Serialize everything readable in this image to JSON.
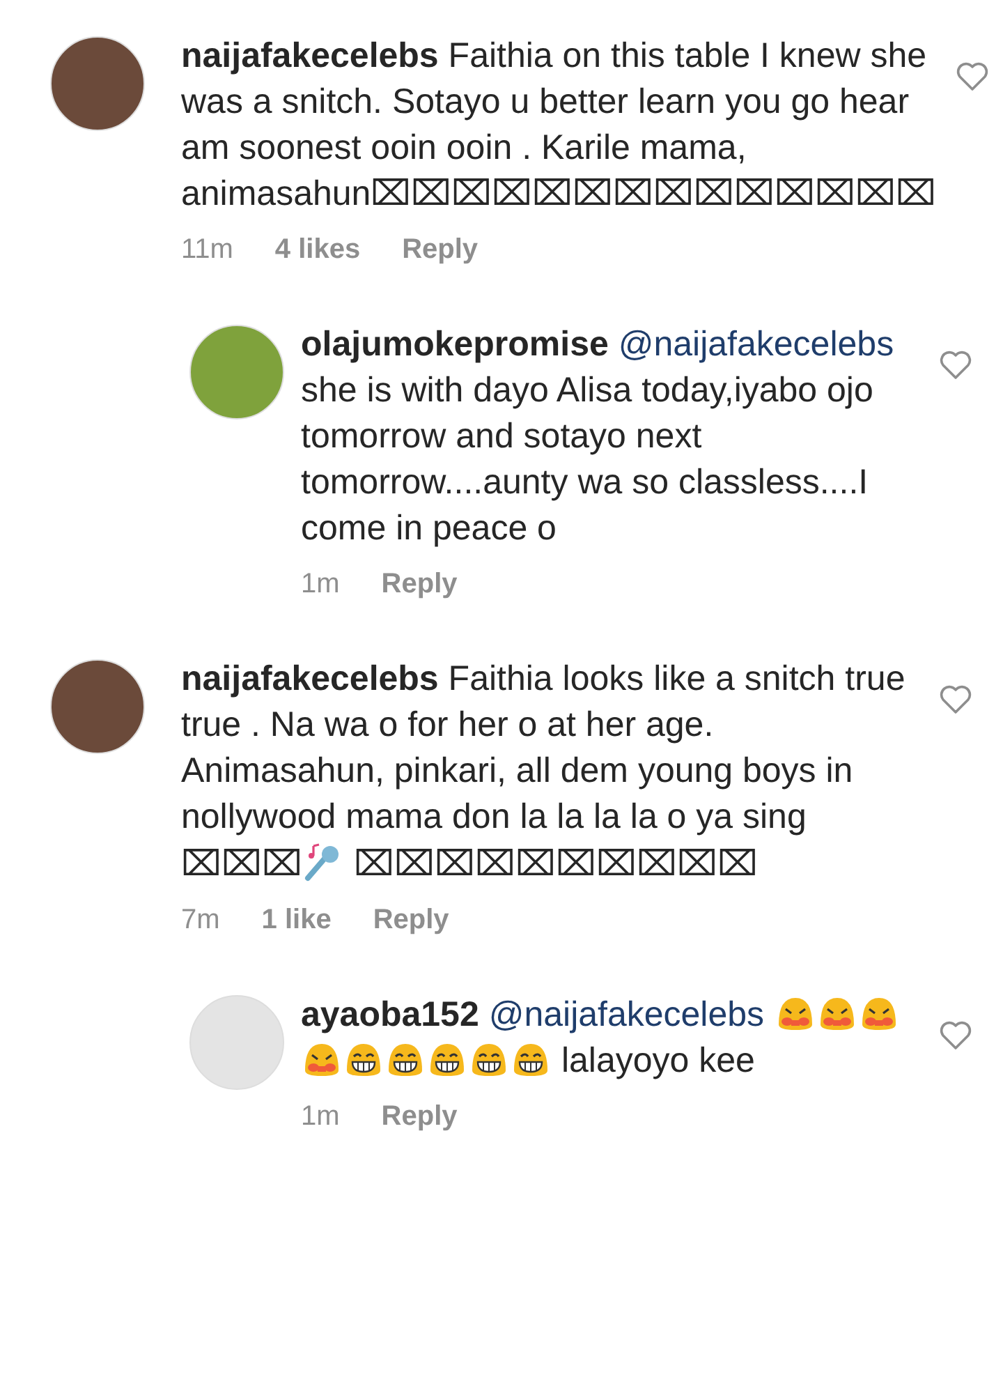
{
  "comments": [
    {
      "reply": false,
      "username": "naijafakecelebs",
      "parts": [
        {
          "kind": "text",
          "text": "Faithia on this table I knew she was a snitch. Sotayo u better learn you go hear am soonest ooin ooin . Karile mama, animasahun⌧⌧⌧⌧⌧⌧⌧⌧⌧⌧⌧⌧⌧⌧"
        }
      ],
      "time": "11m",
      "likes": "4 likes",
      "reply_label": "Reply"
    },
    {
      "reply": true,
      "username": "olajumokepromise",
      "parts": [
        {
          "kind": "mention",
          "text": "@naijafakecelebs"
        },
        {
          "kind": "text",
          "text": " she is with dayo Alisa today,iyabo ojo tomorrow and sotayo next tomorrow....aunty wa so classless....I come in peace o"
        }
      ],
      "time": "1m",
      "reply_label": "Reply"
    },
    {
      "reply": false,
      "username": "naijafakecelebs",
      "parts": [
        {
          "kind": "text",
          "text": "Faithia looks like a snitch true true . Na wa o for her o at her age. Animasahun, pinkari, all dem young boys in nollywood mama don la la la la o ya sing ⌧⌧⌧"
        },
        {
          "kind": "mic"
        },
        {
          "kind": "text",
          "text": " ⌧⌧⌧⌧⌧⌧⌧⌧⌧⌧"
        }
      ],
      "time": "7m",
      "likes": "1 like",
      "reply_label": "Reply"
    },
    {
      "reply": true,
      "username": "ayaoba152",
      "parts": [
        {
          "kind": "mention",
          "text": "@naijafakecelebs"
        },
        {
          "kind": "persevere"
        },
        {
          "kind": "persevere"
        },
        {
          "kind": "persevere"
        },
        {
          "kind": "persevere"
        },
        {
          "kind": "grin"
        },
        {
          "kind": "grin"
        },
        {
          "kind": "grin"
        },
        {
          "kind": "grin"
        },
        {
          "kind": "grin"
        },
        {
          "kind": "text",
          "text": " lalayoyo kee"
        }
      ],
      "time": "1m",
      "reply_label": "Reply"
    }
  ]
}
